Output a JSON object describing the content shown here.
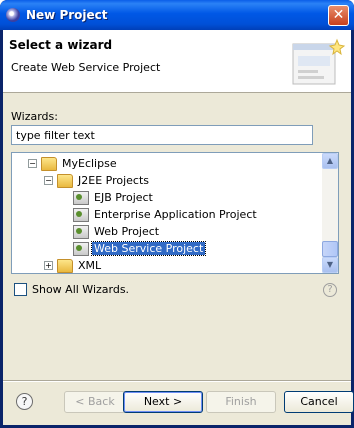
{
  "window": {
    "title": "New Project",
    "close_glyph": "✕"
  },
  "banner": {
    "title": "Select a wizard",
    "description": "Create Web Service Project"
  },
  "wizards": {
    "label": "Wizards:",
    "filter_value": "type filter text",
    "tree": [
      {
        "label": "MyEclipse",
        "expander": "−",
        "icon": "folder-icon"
      },
      {
        "label": "J2EE Projects",
        "expander": "−",
        "icon": "folder-icon"
      },
      {
        "label": "EJB Project",
        "icon": "ejb-project-icon"
      },
      {
        "label": "Enterprise Application Project",
        "icon": "ear-project-icon"
      },
      {
        "label": "Web Project",
        "icon": "web-project-icon"
      },
      {
        "label": "Web Service Project",
        "icon": "web-service-project-icon",
        "selected": true
      },
      {
        "label": "XML",
        "expander": "+",
        "icon": "folder-icon"
      }
    ]
  },
  "show_all": {
    "label": "Show All Wizards.",
    "checked": false
  },
  "buttons": {
    "back": "< Back",
    "next": "Next >",
    "finish": "Finish",
    "cancel": "Cancel"
  },
  "icons": {
    "help": "?"
  }
}
